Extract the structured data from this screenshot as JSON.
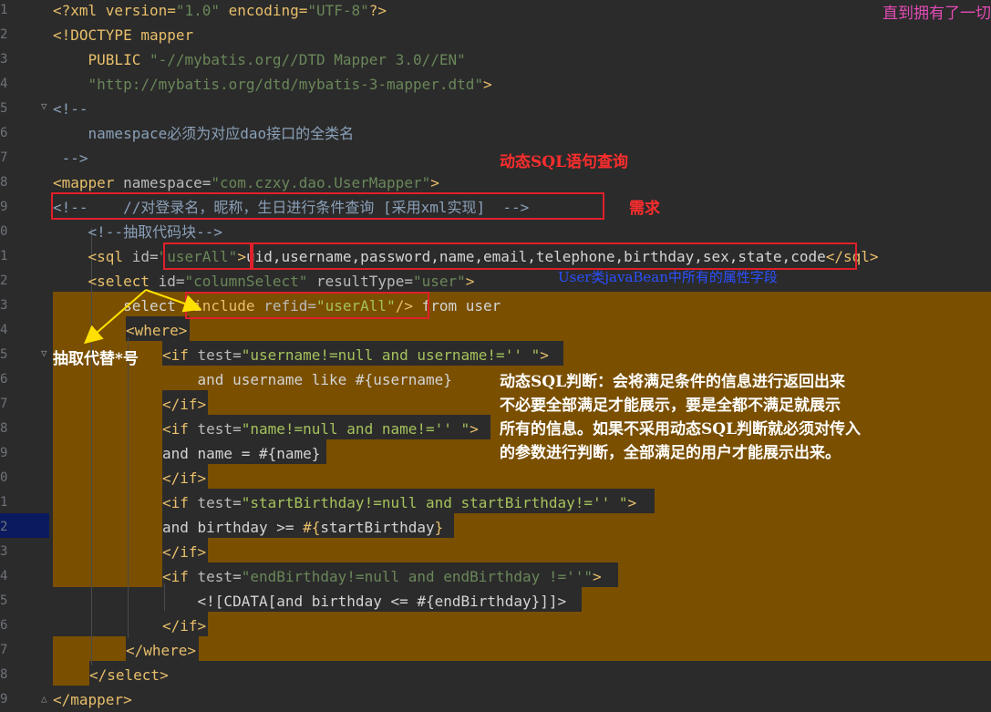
{
  "editor": {
    "line_numbers": [
      "1",
      "2",
      "3",
      "4",
      "5",
      "6",
      "7",
      "8",
      "9",
      "0",
      "1",
      "2",
      "3",
      "4",
      "5",
      "6",
      "7",
      "8",
      "9",
      "0",
      "1",
      "2",
      "3",
      "4",
      "5",
      "6",
      "7",
      "8",
      "9"
    ],
    "lines": {
      "l1": {
        "a": "<?xml version=",
        "b": "\"1.0\"",
        "c": " encoding=",
        "d": "\"UTF-8\"",
        "e": "?>"
      },
      "l2": {
        "a": "<!DOCTYPE mapper"
      },
      "l3": {
        "a": "    PUBLIC ",
        "b": "\"-//mybatis.org//DTD Mapper 3.0//EN\""
      },
      "l4": {
        "a": "    ",
        "b": "\"http://mybatis.org/dtd/mybatis-3-mapper.dtd\"",
        "c": ">"
      },
      "l5": {
        "a": "<!--"
      },
      "l6": {
        "a": "    namespace必须为对应dao接口的全类名"
      },
      "l7": {
        "a": " -->"
      },
      "l8": {
        "a": "<mapper ",
        "b": "namespace=",
        "c": "\"com.czxy.dao.UserMapper\"",
        "d": ">"
      },
      "l9": {
        "a": "<!--    //对登录名，昵称，生日进行条件查询 [采用xml实现]  -->"
      },
      "l10": {
        "a": "    <!--抽取代码块-->"
      },
      "l11": {
        "a": "    <sql ",
        "b": "id=",
        "c": "\"userAll\"",
        "d": ">",
        "e": "uid,username,password,name,email,telephone,birthday,sex,state,code",
        "f": "</sql>"
      },
      "l12": {
        "a": "    <select ",
        "b": "id=",
        "c": "\"columnSelect\"",
        "d": " resultType=",
        "e": "\"user\"",
        "f": ">"
      },
      "l13": {
        "a": "        select ",
        "b": "<include ",
        "c": "refid=",
        "d": "\"userAll\"",
        "e": "/>",
        "f": " from user"
      },
      "l14": {
        "a": "<where>"
      },
      "l15": {
        "a": "<if ",
        "b": "test=",
        "c": "\"username!=null and username!='' \"",
        "d": ">"
      },
      "l16": {
        "a": "    and username like #{username}"
      },
      "l17": {
        "a": "</if>"
      },
      "l18": {
        "a": "<if ",
        "b": "test=",
        "c": "\"name!=null and name!='' \"",
        "d": ">"
      },
      "l19": {
        "a": "and name = #{name}"
      },
      "l20": {
        "a": "</if>"
      },
      "l21": {
        "a": "<if ",
        "b": "test=",
        "c": "\"startBirthday!=null and startBirthday!='' \"",
        "d": ">"
      },
      "l22": {
        "a": "and birthday >= ",
        "b": "#{",
        "c": "startBirthday",
        "d": "}"
      },
      "l23": {
        "a": "</if>"
      },
      "l24": {
        "a": "<if ",
        "b": "test=",
        "c": "\"endBirthday!=null and endBirthday !=''\"",
        "d": ">"
      },
      "l25": {
        "a": "    <![CDATA[",
        "b": "and birthday <= #{endBirthday}",
        "c": "]]>"
      },
      "l26": {
        "a": "</if>"
      },
      "l27": {
        "a": "</where>"
      },
      "l28": {
        "a": "</select>"
      },
      "l29": {
        "a": "</mapper>"
      }
    }
  },
  "annotations": {
    "corner": "直到拥有了一切",
    "dynamic_sql_query": "动态SQL语句查询",
    "requirement": "需求",
    "javabean_fields": "User类javaBean中所有的属性字段",
    "extract_replace": "抽取代替*号",
    "dynamic_judge": [
      "动态SQL判断：会将满足条件的信息进行返回出来",
      "不必要全部满足才能展示，要是全都不满足就展示",
      "所有的信息。如果不采用动态SQL判断就必须对传入",
      "的参数进行判断，全部满足的用户才能展示出来。"
    ]
  },
  "colors": {
    "background": "#2b2b2b",
    "highlight": "#7a4f00",
    "red_box": "#e0202a",
    "tag": "#e8bf6a",
    "string": "#6a8759"
  }
}
